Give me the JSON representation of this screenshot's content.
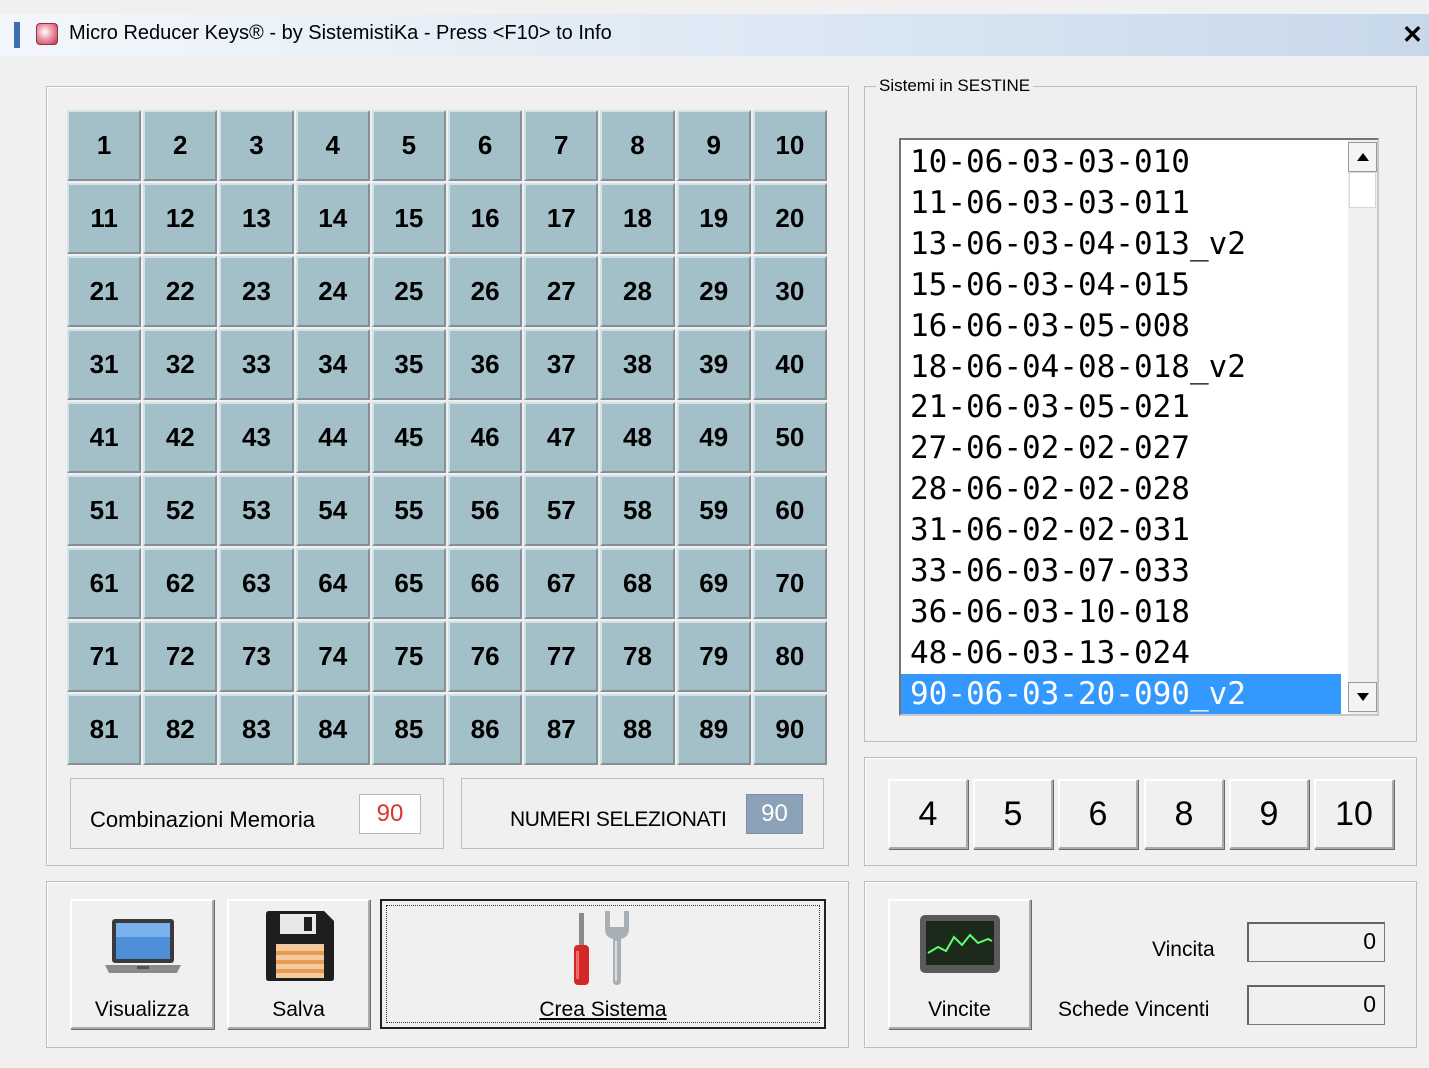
{
  "window": {
    "title": "Micro Reducer Keys® - by SistemistiKa - Press <F10> to Info",
    "close_glyph": "✕",
    "icon": "app-flower-icon"
  },
  "numbers": {
    "grid": [
      1,
      2,
      3,
      4,
      5,
      6,
      7,
      8,
      9,
      10,
      11,
      12,
      13,
      14,
      15,
      16,
      17,
      18,
      19,
      20,
      21,
      22,
      23,
      24,
      25,
      26,
      27,
      28,
      29,
      30,
      31,
      32,
      33,
      34,
      35,
      36,
      37,
      38,
      39,
      40,
      41,
      42,
      43,
      44,
      45,
      46,
      47,
      48,
      49,
      50,
      51,
      52,
      53,
      54,
      55,
      56,
      57,
      58,
      59,
      60,
      61,
      62,
      63,
      64,
      65,
      66,
      67,
      68,
      69,
      70,
      71,
      72,
      73,
      74,
      75,
      76,
      77,
      78,
      79,
      80,
      81,
      82,
      83,
      84,
      85,
      86,
      87,
      88,
      89,
      90
    ],
    "button_color": "#a3bfc8"
  },
  "memory": {
    "label": "Combinazioni Memoria",
    "value": "90",
    "value_color": "#e03030"
  },
  "selected": {
    "label": "NUMERI SELEZIONATI",
    "value": "90",
    "badge_color": "#8ca2b8"
  },
  "systems": {
    "group_label": "Sistemi in SESTINE",
    "items": [
      "10-06-03-03-010",
      "11-06-03-03-011",
      "13-06-03-04-013_v2",
      "15-06-03-04-015",
      "16-06-03-05-008",
      "18-06-04-08-018_v2",
      "21-06-03-05-021",
      "27-06-02-02-027",
      "28-06-02-02-028",
      "31-06-02-02-031",
      "33-06-03-07-033",
      "36-06-03-10-018",
      "48-06-03-13-024",
      "90-06-03-20-090_v2"
    ],
    "selected_index": 13,
    "selection_color": "#3399ff"
  },
  "size_buttons": [
    "4",
    "5",
    "6",
    "8",
    "9",
    "10"
  ],
  "actions": {
    "view": {
      "label": "Visualizza",
      "icon": "laptop-icon"
    },
    "save": {
      "label": "Salva",
      "icon": "floppy-disk-icon"
    },
    "create": {
      "label": "Crea Sistema",
      "icon": "tools-icon"
    }
  },
  "wins": {
    "button_label": "Vincite",
    "button_icon": "monitor-chart-icon",
    "vincita_label": "Vincita",
    "vincita_value": "0",
    "schede_label": "Schede Vincenti",
    "schede_value": "0"
  }
}
